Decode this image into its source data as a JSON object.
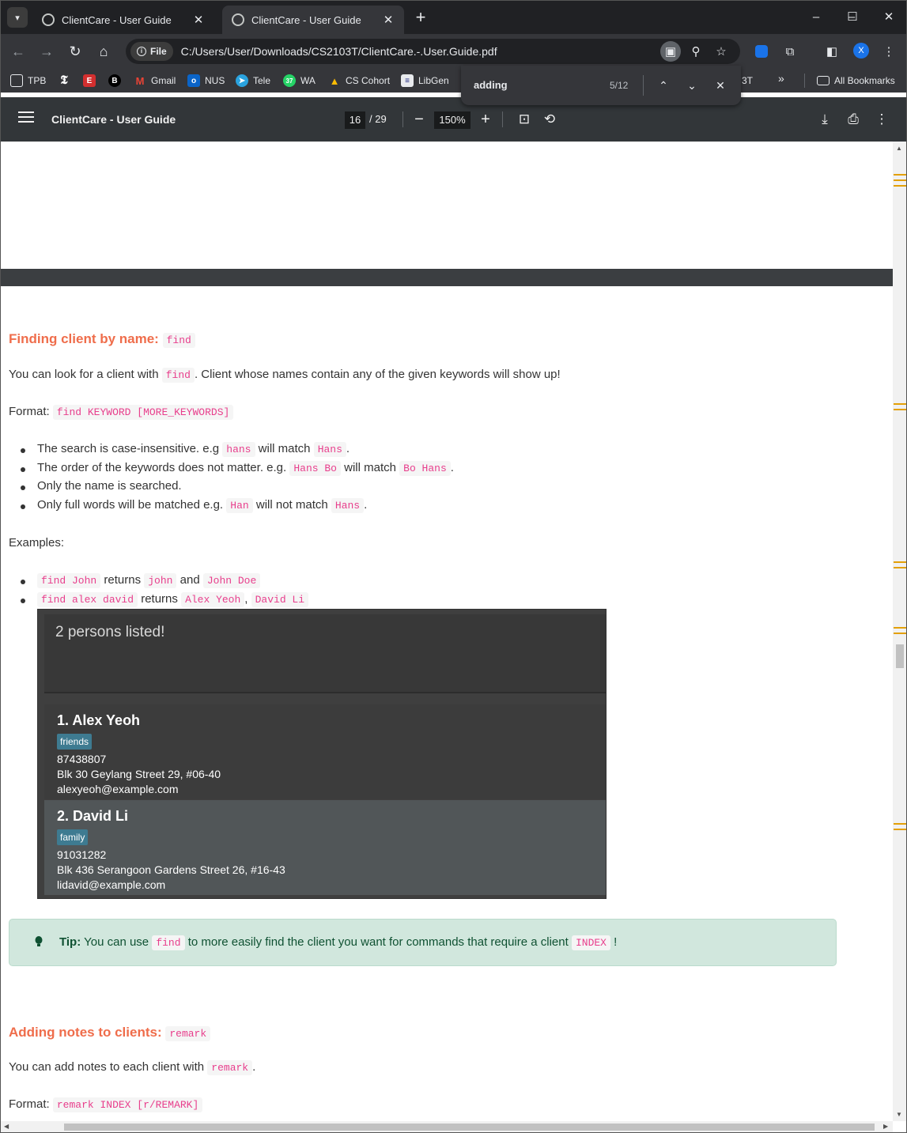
{
  "tabs": [
    {
      "title": "ClientCare - User Guide",
      "active": false
    },
    {
      "title": "ClientCare - User Guide",
      "active": true
    }
  ],
  "window_controls": {
    "minimize": "–",
    "maximize": "☐",
    "close": "✕"
  },
  "address": {
    "chip": "File",
    "url": "C:/Users/User/Downloads/CS2103T/ClientCare.-.User.Guide.pdf"
  },
  "bookmarks": [
    {
      "label": "TPB",
      "icon": "monitor-icon"
    },
    {
      "label": "",
      "icon": "nyt-icon"
    },
    {
      "label": "",
      "icon": "e-icon"
    },
    {
      "label": "",
      "icon": "b-icon"
    },
    {
      "label": "Gmail",
      "icon": "gmail-icon"
    },
    {
      "label": "NUS",
      "icon": "outlook-icon"
    },
    {
      "label": "Tele",
      "icon": "telegram-icon"
    },
    {
      "label": "WA",
      "icon": "whatsapp-icon"
    },
    {
      "label": "CS Cohort",
      "icon": "drive-icon"
    },
    {
      "label": "LibGen",
      "icon": "book-icon"
    }
  ],
  "bookmarks_partial": "3T",
  "all_bookmarks": "All Bookmarks",
  "find": {
    "query": "adding",
    "count": "5/12"
  },
  "pdf": {
    "title": "ClientCare - User Guide",
    "page": "16",
    "total": "/ 29",
    "zoom": "150%"
  },
  "doc": {
    "find_section": {
      "heading": "Finding client by name:",
      "heading_code": "find",
      "intro_pre": "You can look for a client with",
      "intro_code": "find",
      "intro_post": ". Client whose names contain any of the given keywords will show up!",
      "format_label": "Format:",
      "format_code": "find KEYWORD [MORE_KEYWORDS]",
      "bullets": [
        {
          "pre": "The search is case-insensitive. e.g",
          "c1": "hans",
          "mid": "will match",
          "c2": "Hans",
          "post": "."
        },
        {
          "pre": "The order of the keywords does not matter. e.g.",
          "c1": "Hans Bo",
          "mid": "will match",
          "c2": "Bo Hans",
          "post": "."
        },
        {
          "pre": "Only the name is searched.",
          "c1": "",
          "mid": "",
          "c2": "",
          "post": ""
        },
        {
          "pre": "Only full words will be matched e.g.",
          "c1": "Han",
          "mid": "will not match",
          "c2": "Hans",
          "post": "."
        }
      ],
      "examples_label": "Examples:",
      "examples": [
        {
          "c1": "find John",
          "mid": "returns",
          "c2": "john",
          "sep": "and",
          "c3": "John Doe"
        },
        {
          "c1": "find alex david",
          "mid": "returns",
          "c2": "Alex Yeoh",
          "sep": ",",
          "c3": "David Li"
        }
      ]
    },
    "screenshot": {
      "result": "2 persons listed!",
      "persons": [
        {
          "index_name": "1.  Alex Yeoh",
          "tag": "friends",
          "phone": "87438807",
          "address": "Blk 30 Geylang Street 29, #06-40",
          "email": "alexyeoh@example.com"
        },
        {
          "index_name": "2.  David Li",
          "tag": "family",
          "phone": "91031282",
          "address": "Blk 436 Serangoon Gardens Street 26, #16-43",
          "email": "lidavid@example.com"
        }
      ]
    },
    "tip": {
      "label": "Tip:",
      "pre": "You can use",
      "code": "find",
      "mid": "to more easily find the client you want for commands that require a client",
      "code2": "INDEX",
      "post": "!"
    },
    "remark_section": {
      "heading": "Adding notes to clients:",
      "heading_code": "remark",
      "intro_pre": "You can add notes to each client with",
      "intro_code": "remark",
      "intro_post": ".",
      "format_label": "Format:",
      "format_code": "remark INDEX [r/REMARK]"
    }
  },
  "colors": {
    "heading": "#ef6d4b",
    "code": "#e83e8c",
    "tip_bg": "#d1e7dd",
    "find_match": "#e3a008"
  }
}
